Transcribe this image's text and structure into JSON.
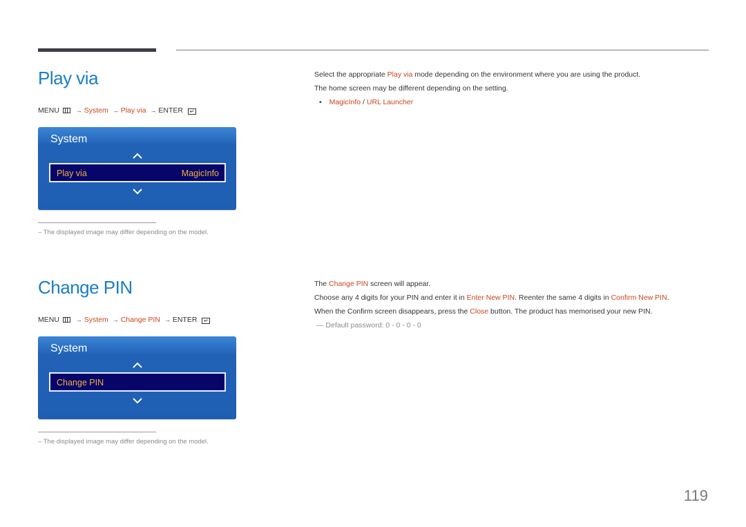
{
  "page_number": "119",
  "common": {
    "menu_label": "MENU",
    "enter_label": "ENTER",
    "arrow": "→",
    "system_label": "System",
    "note": "–  The displayed image may differ depending on the model."
  },
  "play_via": {
    "title": "Play via",
    "menu_path": [
      "System",
      "Play via"
    ],
    "osd": {
      "title": "System",
      "row_label": "Play via",
      "row_value": "MagicInfo"
    },
    "description": {
      "line1_pre": "Select the appropriate ",
      "line1_hl": "Play via",
      "line1_post": " mode depending on the environment where you are using the product.",
      "line2": "The home screen may be different depending on the setting.",
      "bullet_mark": "•",
      "bullet_opt1": "MagicInfo",
      "bullet_sep": " / ",
      "bullet_opt2": "URL Launcher"
    }
  },
  "change_pin": {
    "title": "Change PIN",
    "menu_path": [
      "System",
      "Change PIN"
    ],
    "osd": {
      "title": "System",
      "row_label": "Change PIN",
      "row_value": ""
    },
    "description": {
      "line1_pre": "The ",
      "line1_hl": "Change PIN",
      "line1_post": " screen will appear.",
      "line2_pre": "Choose any 4 digits for your PIN and enter it in ",
      "line2_hl1": "Enter New PIN",
      "line2_mid": ". Reenter the same 4 digits in ",
      "line2_hl2": "Confirm New PIN",
      "line2_post": ".",
      "line3_pre": "When the Confirm screen disappears, press the ",
      "line3_hl": "Close",
      "line3_post": " button. The product has memorised your new PIN.",
      "default_password": "―  Default password: 0 - 0 - 0 - 0"
    }
  },
  "colors": {
    "title_blue": "#1a7ec6",
    "highlight_orange": "#c8461e",
    "osd_blue": "#1f5fb3",
    "osd_row_bg": "#07056a",
    "osd_row_text": "#f2b13a"
  }
}
